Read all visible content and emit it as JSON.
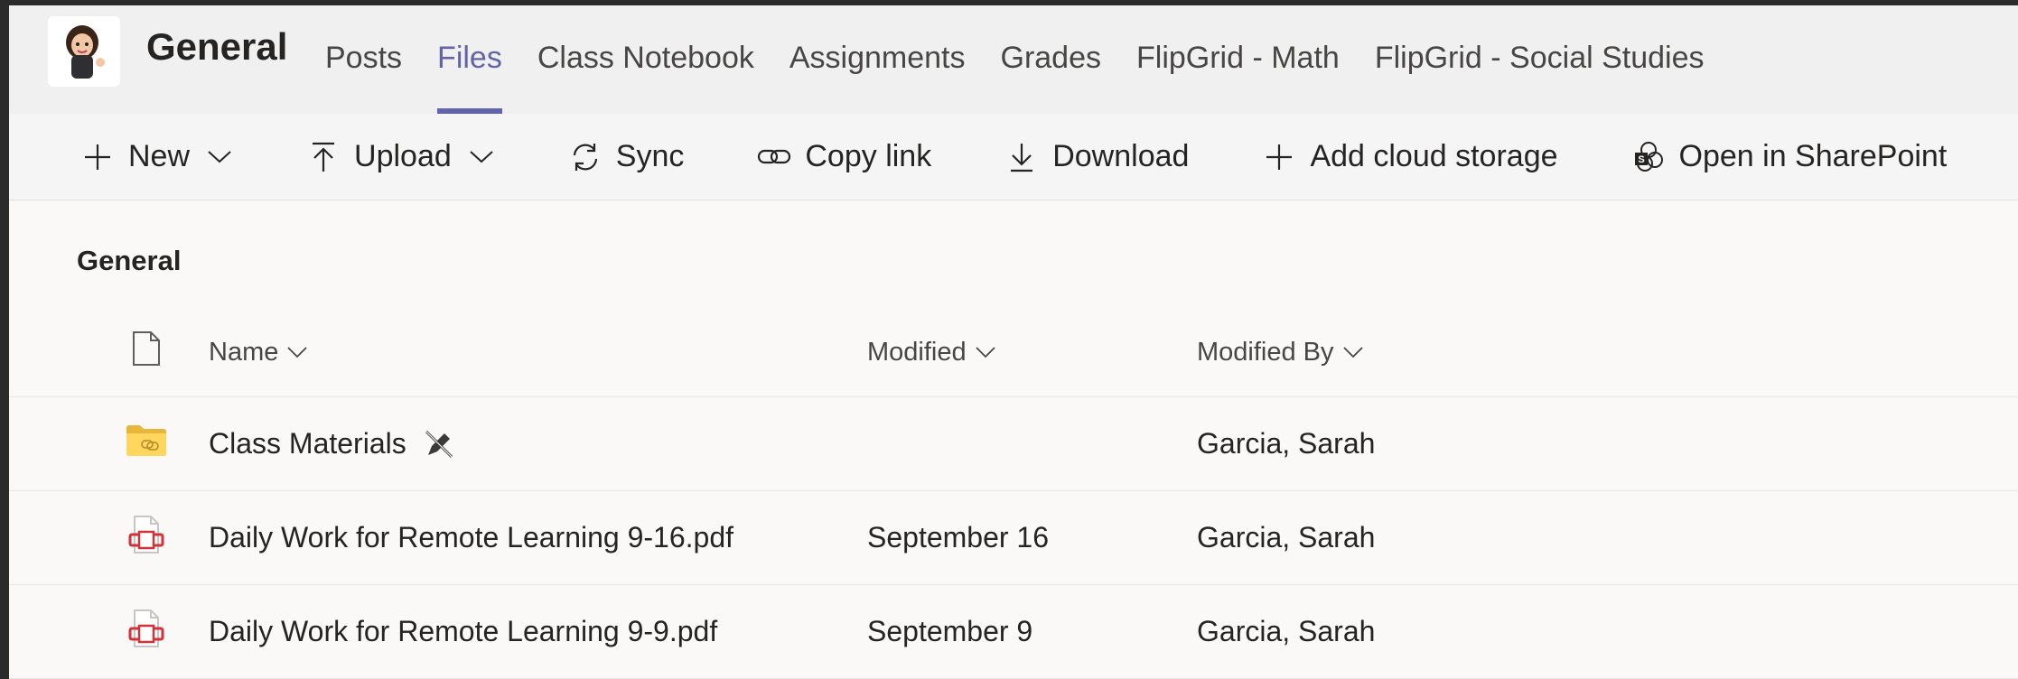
{
  "header": {
    "channel_title": "General",
    "tabs": [
      {
        "label": "Posts",
        "active": false
      },
      {
        "label": "Files",
        "active": true
      },
      {
        "label": "Class Notebook",
        "active": false
      },
      {
        "label": "Assignments",
        "active": false
      },
      {
        "label": "Grades",
        "active": false
      },
      {
        "label": "FlipGrid - Math",
        "active": false
      },
      {
        "label": "FlipGrid - Social Studies",
        "active": false
      }
    ]
  },
  "toolbar": {
    "new_label": "New",
    "upload_label": "Upload",
    "sync_label": "Sync",
    "copy_link_label": "Copy link",
    "download_label": "Download",
    "add_cloud_label": "Add cloud storage",
    "open_sharepoint_label": "Open in SharePoint"
  },
  "files": {
    "folder_title": "General",
    "columns": {
      "name": "Name",
      "modified": "Modified",
      "modified_by": "Modified By"
    },
    "rows": [
      {
        "type": "folder",
        "name": "Class Materials",
        "modified": "",
        "modified_by": "Garcia, Sarah"
      },
      {
        "type": "pdf",
        "name": "Daily Work for Remote Learning 9-16.pdf",
        "modified": "September 16",
        "modified_by": "Garcia, Sarah"
      },
      {
        "type": "pdf",
        "name": "Daily Work for Remote Learning 9-9.pdf",
        "modified": "September 9",
        "modified_by": "Garcia, Sarah"
      }
    ]
  },
  "colors": {
    "accent": "#6264a7",
    "folder": "#ffd75e",
    "pdf": "#d13438"
  }
}
